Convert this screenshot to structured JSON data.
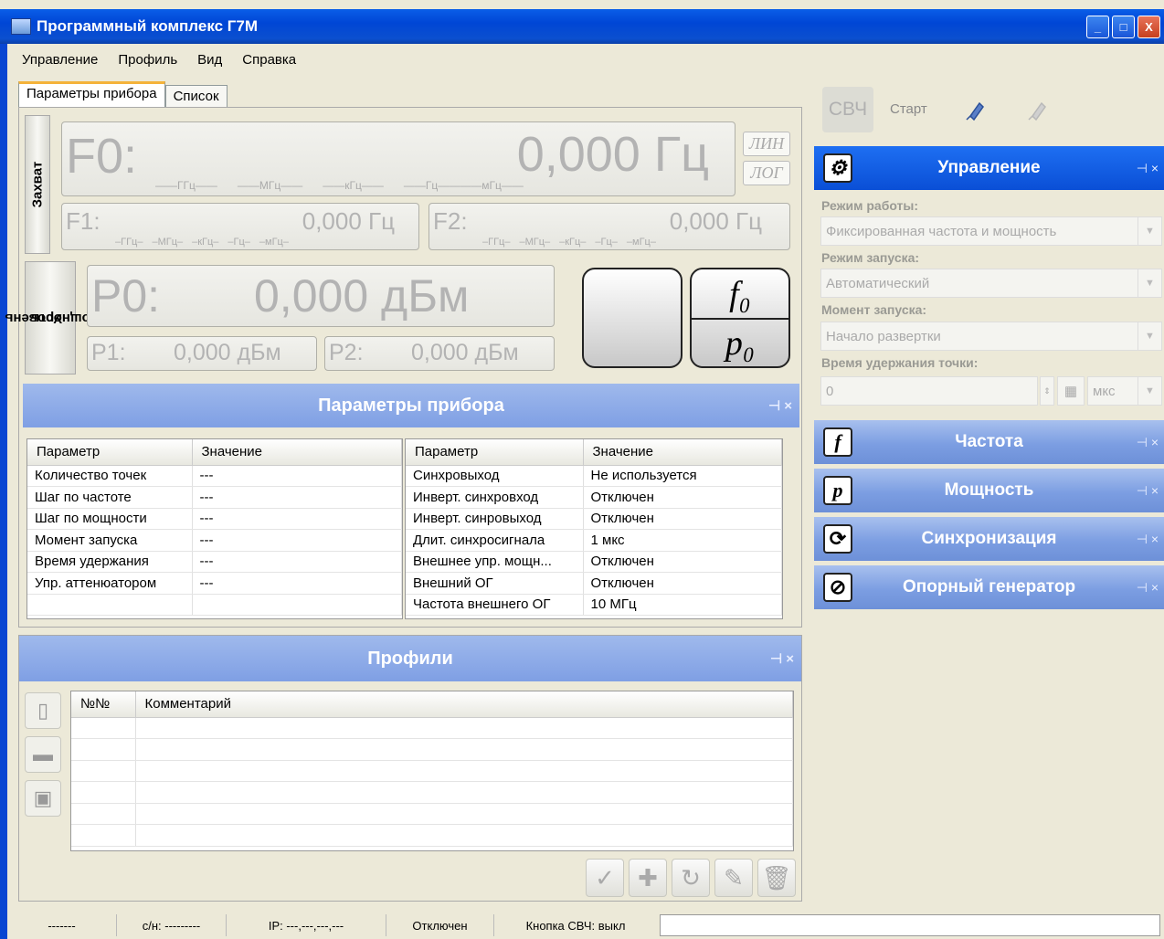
{
  "window": {
    "title": "Программный комплекс Г7М",
    "buttons": [
      "_",
      "□",
      "X"
    ]
  },
  "menu": [
    "Управление",
    "Профиль",
    "Вид",
    "Справка"
  ],
  "tabs": [
    "Параметры прибора",
    "Список"
  ],
  "capture": {
    "side_label": "Захват",
    "f0_label": "F0:",
    "f0_value": "0,000 Гц",
    "f0_units": [
      "——ГГц——",
      "——МГц——",
      "——кГц——",
      "——Гц——",
      "——мГц——"
    ],
    "f1_label": "F1:",
    "f1_value": "0,000 Гц",
    "f2_label": "F2:",
    "f2_value": "0,000 Гц",
    "small_units": [
      "–ГГц–",
      "–МГц–",
      "–кГц–",
      "–Гц–",
      "–мГц–"
    ],
    "lin": "ЛИН",
    "log": "ЛОГ"
  },
  "power": {
    "side_label_1": "Уровень",
    "side_label_2": "Мощность",
    "p0_label": "P0:",
    "p0_value": "0,000 дБм",
    "p1_label": "P1:",
    "p1_value": "0,000 дБм",
    "p2_label": "P2:",
    "p2_value": "0,000 дБм",
    "f0_glyph": "f₀",
    "p0_glyph": "p₀"
  },
  "params_section": {
    "title": "Параметры прибора",
    "pin": "⊣ ×",
    "left_headers": [
      "Параметр",
      "Значение"
    ],
    "left_rows": [
      [
        "Количество точек",
        "---"
      ],
      [
        "Шаг по частоте",
        "---"
      ],
      [
        "Шаг по мощности",
        "---"
      ],
      [
        "Момент запуска",
        "---"
      ],
      [
        "Время удержания",
        "---"
      ],
      [
        "Упр. аттенюатором",
        "---"
      ],
      [
        "",
        ""
      ]
    ],
    "right_headers": [
      "Параметр",
      "Значение"
    ],
    "right_rows": [
      [
        "Синхровыход",
        "Не используется"
      ],
      [
        "Инверт. синхровход",
        "Отключен"
      ],
      [
        "Инверт. синровыход",
        "Отключен"
      ],
      [
        "Длит. синхросигнала",
        "1 мкс"
      ],
      [
        "Внешнее упр. мощн...",
        "Отключен"
      ],
      [
        "Внешний ОГ",
        "Отключен"
      ],
      [
        "Частота внешнего ОГ",
        "10 МГц"
      ]
    ]
  },
  "profiles": {
    "title": "Профили",
    "pin": "⊣ ×",
    "headers": [
      "№№",
      "Комментарий"
    ],
    "empty_rows": 6
  },
  "toolbar": {
    "svch": "СВЧ",
    "start": "Старт"
  },
  "control": {
    "title": "Управление",
    "mode_label": "Режим работы:",
    "mode_value": "Фиксированная частота и мощность",
    "launch_label": "Режим запуска:",
    "launch_value": "Автоматический",
    "moment_label": "Момент запуска:",
    "moment_value": "Начало развертки",
    "hold_label": "Время удержания точки:",
    "hold_value": "0",
    "hold_unit": "мкс"
  },
  "dock_sections": [
    {
      "title": "Частота",
      "glyph": "f"
    },
    {
      "title": "Мощность",
      "glyph": "p"
    },
    {
      "title": "Синхронизация",
      "glyph": "⟳"
    },
    {
      "title": "Опорный генератор",
      "glyph": "⊘"
    }
  ],
  "status": {
    "s1": "-------",
    "s2": "с/н: ---------",
    "s3": "IP: ---,---,---,---",
    "s4": "Отключен",
    "s5": "Кнопка СВЧ: выкл"
  }
}
